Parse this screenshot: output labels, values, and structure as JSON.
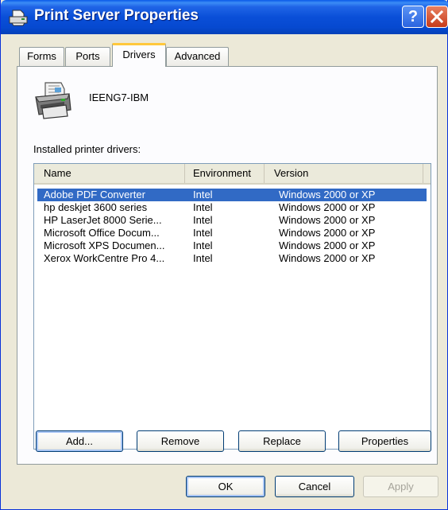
{
  "window": {
    "title": "Print Server Properties",
    "help_label": "?",
    "close_label": "X"
  },
  "tabs": [
    {
      "label": "Forms"
    },
    {
      "label": "Ports"
    },
    {
      "label": "Drivers",
      "active": true
    },
    {
      "label": "Advanced"
    }
  ],
  "server": {
    "name": "IEENG7-IBM",
    "icon": "printer-icon"
  },
  "drivers": {
    "label": "Installed printer drivers:",
    "columns": [
      "Name",
      "Environment",
      "Version"
    ],
    "rows": [
      {
        "name": "Adobe PDF Converter",
        "environment": "Intel",
        "version": "Windows 2000 or XP",
        "selected": true
      },
      {
        "name": "hp deskjet 3600 series",
        "environment": "Intel",
        "version": "Windows 2000 or XP"
      },
      {
        "name": "HP LaserJet 8000 Serie...",
        "environment": "Intel",
        "version": "Windows 2000 or XP"
      },
      {
        "name": "Microsoft Office Docum...",
        "environment": "Intel",
        "version": "Windows 2000 or XP"
      },
      {
        "name": "Microsoft XPS Documen...",
        "environment": "Intel",
        "version": "Windows 2000 or XP"
      },
      {
        "name": "Xerox WorkCentre Pro 4...",
        "environment": "Intel",
        "version": "Windows 2000 or XP"
      }
    ]
  },
  "panel_buttons": {
    "add": "Add...",
    "remove": "Remove",
    "replace": "Replace",
    "properties": "Properties"
  },
  "dialog_buttons": {
    "ok": "OK",
    "cancel": "Cancel",
    "apply": "Apply"
  },
  "colors": {
    "titlebar": "#0A4FD8",
    "selection": "#316AC5",
    "active_tab_accent": "#FFC83C"
  }
}
